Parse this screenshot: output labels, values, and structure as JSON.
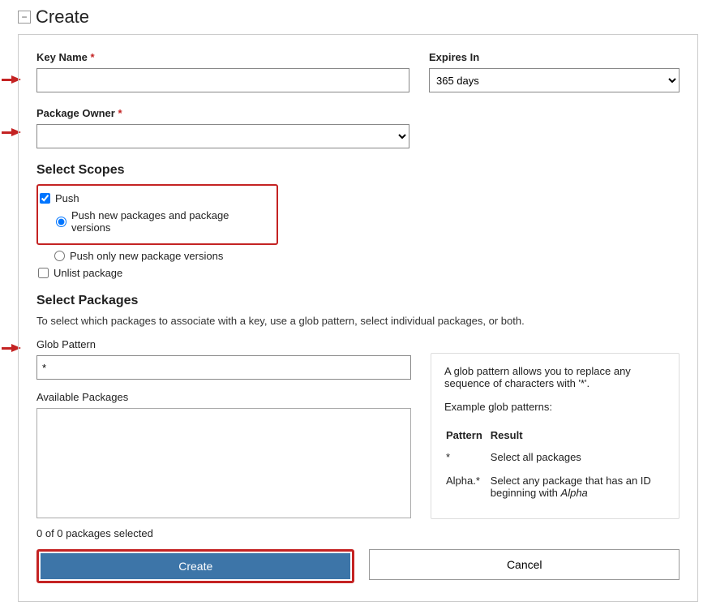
{
  "header": {
    "collapse_symbol": "−",
    "title": "Create"
  },
  "form": {
    "key_name": {
      "label": "Key Name",
      "required": "*",
      "value": ""
    },
    "expires_in": {
      "label": "Expires In",
      "selected": "365 days"
    },
    "package_owner": {
      "label": "Package Owner",
      "required": "*",
      "selected": ""
    }
  },
  "scopes": {
    "heading": "Select Scopes",
    "push": {
      "label": "Push",
      "checked": true
    },
    "push_new": {
      "label": "Push new packages and package versions",
      "checked": true
    },
    "push_only_versions": {
      "label": "Push only new package versions",
      "checked": false
    },
    "unlist": {
      "label": "Unlist package",
      "checked": false
    }
  },
  "packages": {
    "heading": "Select Packages",
    "description": "To select which packages to associate with a key, use a glob pattern, select individual packages, or both.",
    "glob_label": "Glob Pattern",
    "glob_value": "*",
    "available_label": "Available Packages",
    "count_text": "0 of 0 packages selected"
  },
  "help": {
    "intro": "A glob pattern allows you to replace any sequence of characters with '*'.",
    "examples_intro": "Example glob patterns:",
    "col_pattern": "Pattern",
    "col_result": "Result",
    "rows": [
      {
        "pattern": "*",
        "result": "Select all packages"
      },
      {
        "pattern": "Alpha.*",
        "result_prefix": "Select any package that has an ID beginning with ",
        "result_em": "Alpha"
      }
    ]
  },
  "buttons": {
    "create": "Create",
    "cancel": "Cancel"
  }
}
